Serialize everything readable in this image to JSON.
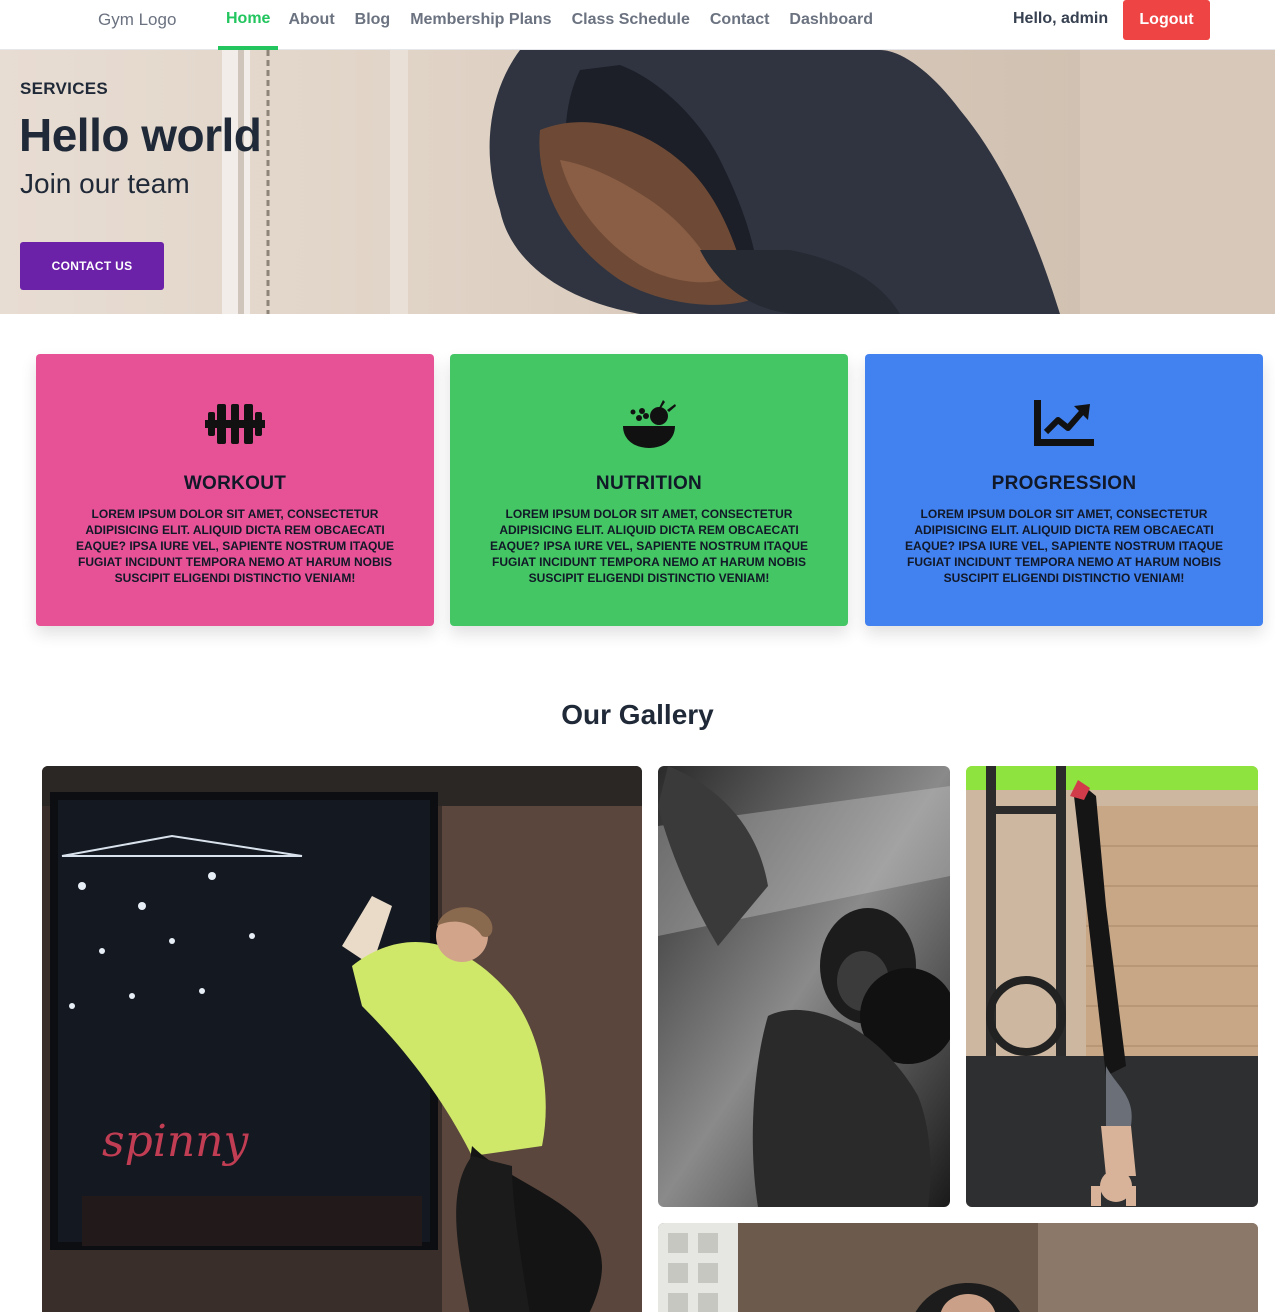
{
  "nav": {
    "logo": "Gym Logo",
    "links": [
      {
        "label": "Home",
        "active": true
      },
      {
        "label": "About",
        "active": false
      },
      {
        "label": "Blog",
        "active": false
      },
      {
        "label": "Membership Plans",
        "active": false
      },
      {
        "label": "Class Schedule",
        "active": false
      },
      {
        "label": "Contact",
        "active": false
      },
      {
        "label": "Dashboard",
        "active": false
      }
    ],
    "greeting": "Hello, admin",
    "logout_label": "Logout"
  },
  "hero": {
    "kicker": "SERVICES",
    "title": "Hello world",
    "subtitle": "Join our team",
    "button_label": "CONTACT US"
  },
  "services": [
    {
      "title": "WORKOUT",
      "icon": "dumbbell-icon",
      "color": "#e75297",
      "text": "Lorem ipsum dolor sit amet, consectetur adipisicing elit. Aliquid dicta rem obcaecati eaque? Ipsa iure vel, sapiente nostrum itaque fugiat incidunt tempora nemo at harum nobis suscipit eligendi distinctio veniam!"
    },
    {
      "title": "NUTRITION",
      "icon": "food-bowl-icon",
      "color": "#45c665",
      "text": "Lorem ipsum dolor sit amet, consectetur adipisicing elit. Aliquid dicta rem obcaecati eaque? Ipsa iure vel, sapiente nostrum itaque fugiat incidunt tempora nemo at harum nobis suscipit eligendi distinctio veniam!"
    },
    {
      "title": "PROGRESSION",
      "icon": "chart-line-icon",
      "color": "#4281f0",
      "text": "Lorem ipsum dolor sit amet, consectetur adipisicing elit. Aliquid dicta rem obcaecati eaque? Ipsa iure vel, sapiente nostrum itaque fugiat incidunt tempora nemo at harum nobis suscipit eligendi distinctio veniam!"
    }
  ],
  "gallery": {
    "title": "Our Gallery"
  },
  "colors": {
    "accent_green": "#22c55e",
    "logout_red": "#ef4444",
    "hero_button_purple": "#6b21a8"
  }
}
